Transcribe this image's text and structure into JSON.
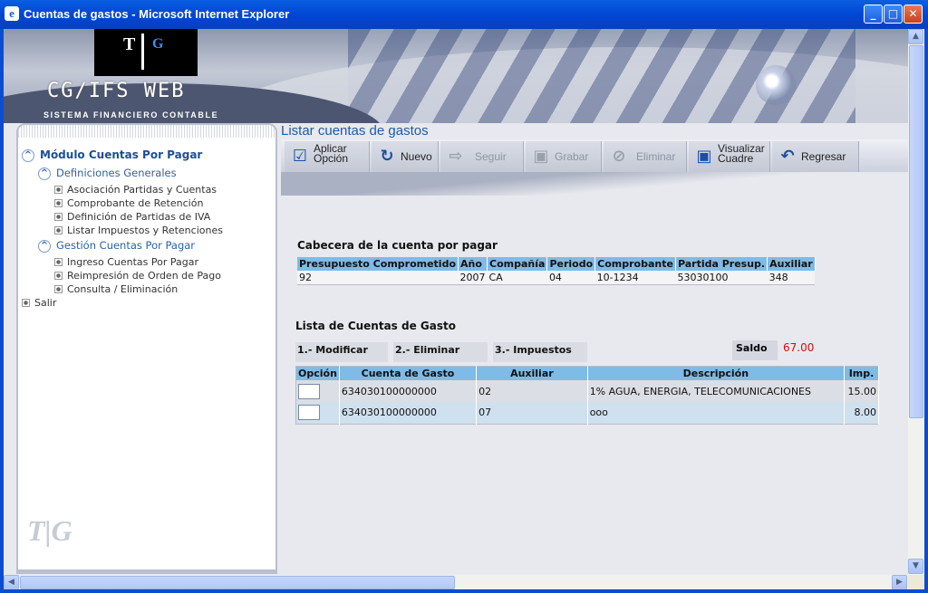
{
  "window": {
    "title": "Cuentas de gastos - Microsoft Internet Explorer",
    "min": "_",
    "max": "□",
    "close": "✕"
  },
  "banner": {
    "logo_t": "T",
    "logo_g": "G",
    "title": "CG/IFS  WEB",
    "subtitle": "SISTEMA FINANCIERO CONTABLE"
  },
  "sidebar": {
    "module": "Módulo Cuentas Por Pagar",
    "groups": [
      {
        "label": "Definiciones Generales",
        "items": [
          "Asociación Partidas y Cuentas",
          "Comprobante de Retención",
          "Definición de Partidas de IVA",
          "Listar Impuestos y Retenciones"
        ]
      },
      {
        "label": "Gestión Cuentas Por Pagar",
        "items": [
          "Ingreso Cuentas Por Pagar",
          "Reimpresión de Orden de Pago",
          "Consulta / Eliminación"
        ]
      }
    ],
    "exit": "Salir",
    "watermark": "T|G"
  },
  "main": {
    "title": "Listar cuentas de gastos",
    "toolbar": {
      "aplicar_1": "Aplicar",
      "aplicar_2": "Opción",
      "nuevo": "Nuevo",
      "seguir": "Seguir",
      "grabar": "Grabar",
      "eliminar": "Eliminar",
      "visualizar_1": "Visualizar",
      "visualizar_2": "Cuadre",
      "regresar": "Regresar"
    },
    "cabecera": {
      "heading": "Cabecera de la cuenta por pagar",
      "columns": [
        "Presupuesto Comprometido",
        "Año",
        "Compañía",
        "Periodo",
        "Comprobante",
        "Partida Presup.",
        "Auxiliar"
      ],
      "row": [
        "92",
        "2007",
        "CA",
        "04",
        "10-1234",
        "53030100",
        "348"
      ]
    },
    "lista": {
      "heading": "Lista de Cuentas de Gasto",
      "options": [
        "1.- Modificar",
        "2.- Eliminar",
        "3.- Impuestos"
      ],
      "saldo_label": "Saldo",
      "saldo_value": "67.00",
      "columns": [
        "Opción",
        "Cuenta de Gasto",
        "Auxiliar",
        "Descripción",
        "Imp."
      ],
      "rows": [
        {
          "cuenta": "634030100000000",
          "auxiliar": "02",
          "descripcion": "1% AGUA, ENERGIA, TELECOMUNICACIONES",
          "imp": "15.00"
        },
        {
          "cuenta": "634030100000000",
          "auxiliar": "07",
          "descripcion": "ooo",
          "imp": "8.00"
        }
      ]
    }
  },
  "colors": {
    "accent": "#1e5aa8",
    "table_header": "#7ebbe6",
    "saldo": "#d01010"
  }
}
